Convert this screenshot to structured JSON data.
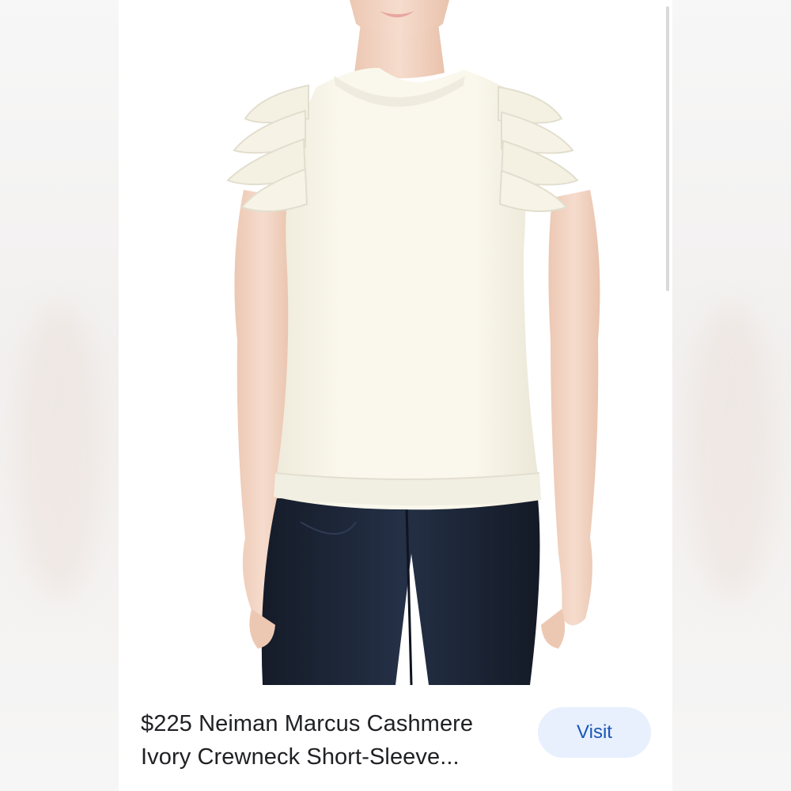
{
  "product": {
    "title_line1": "$225 Neiman Marcus Cashmere",
    "title_line2": "Ivory Crewneck Short-Sleeve...",
    "visit_label": "Visit"
  },
  "colors": {
    "sweater": "#f7f4e6",
    "jeans": "#1d2433",
    "skin": "#f2d6c4",
    "button_bg": "#e8f0fe",
    "button_text": "#1a56b8"
  }
}
